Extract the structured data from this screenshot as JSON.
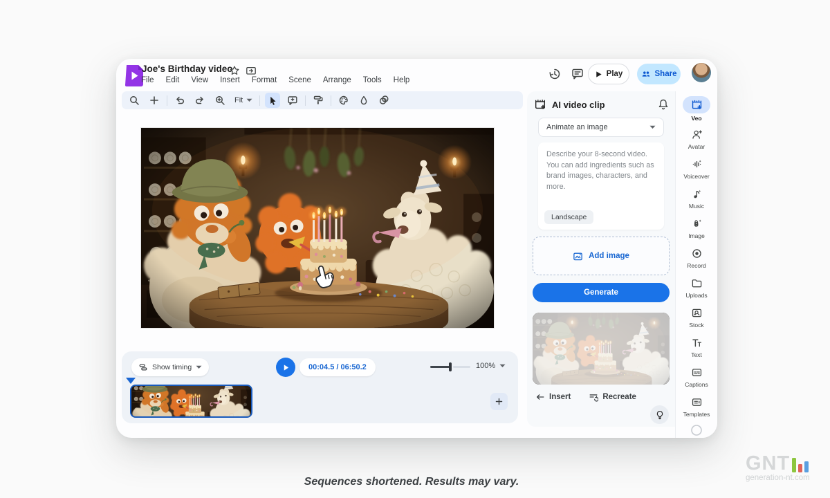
{
  "colors": {
    "accent_blue": "#1a73e8",
    "share_bg": "#c2e7ff",
    "selected_tool_bg": "#d3e3fd",
    "logo_purple": "#9334e6",
    "timeline_border": "#185abc"
  },
  "header": {
    "title": "Joe's Birthday video",
    "menus": [
      "File",
      "Edit",
      "View",
      "Insert",
      "Format",
      "Scene",
      "Arrange",
      "Tools",
      "Help"
    ],
    "actions": {
      "play": "Play",
      "share": "Share"
    },
    "icons": [
      "vids-logo",
      "star-icon",
      "move-folder-icon",
      "version-history-icon",
      "comments-icon",
      "avatar"
    ]
  },
  "toolbar": {
    "zoom_fit": "Fit",
    "selected_tool": "select-cursor",
    "icons": [
      "search-icon",
      "add-icon",
      "undo-icon",
      "redo-icon",
      "zoom-in-icon",
      "select-cursor-icon",
      "add-comment-icon",
      "paint-format-icon",
      "palette-icon",
      "background-icon",
      "transparency-icon"
    ]
  },
  "ai_panel": {
    "title": "AI video clip",
    "mode_selected": "Animate an image",
    "prompt_placeholder": "Describe your 8-second video. You can add ingredients such as brand images, characters, and more.",
    "aspect_chip": "Landscape",
    "add_image": "Add image",
    "generate": "Generate",
    "insert": "Insert",
    "recreate": "Recreate"
  },
  "sidebar": {
    "items": [
      {
        "label": "Veo",
        "icon": "veo-clip-icon",
        "selected": true
      },
      {
        "label": "Avatar",
        "icon": "avatar-add-icon",
        "selected": false
      },
      {
        "label": "Voiceover",
        "icon": "voiceover-icon",
        "selected": false
      },
      {
        "label": "Music",
        "icon": "music-icon",
        "selected": false
      },
      {
        "label": "Image",
        "icon": "image-gen-icon",
        "selected": false
      },
      {
        "label": "Record",
        "icon": "record-icon",
        "selected": false
      },
      {
        "label": "Uploads",
        "icon": "uploads-folder-icon",
        "selected": false
      },
      {
        "label": "Stock",
        "icon": "stock-media-icon",
        "selected": false
      },
      {
        "label": "Text",
        "icon": "text-icon",
        "selected": false
      },
      {
        "label": "Captions",
        "icon": "captions-icon",
        "selected": false
      },
      {
        "label": "Templates",
        "icon": "templates-icon",
        "selected": false
      }
    ]
  },
  "transport": {
    "show_timing": "Show timing",
    "time_display": "00:04.5 / 06:50.2",
    "zoom_level": "100%"
  },
  "footer": {
    "caption": "Sequences shortened. Results may vary."
  },
  "watermark": {
    "brand": "GNT",
    "domain": "generation-nt.com"
  }
}
